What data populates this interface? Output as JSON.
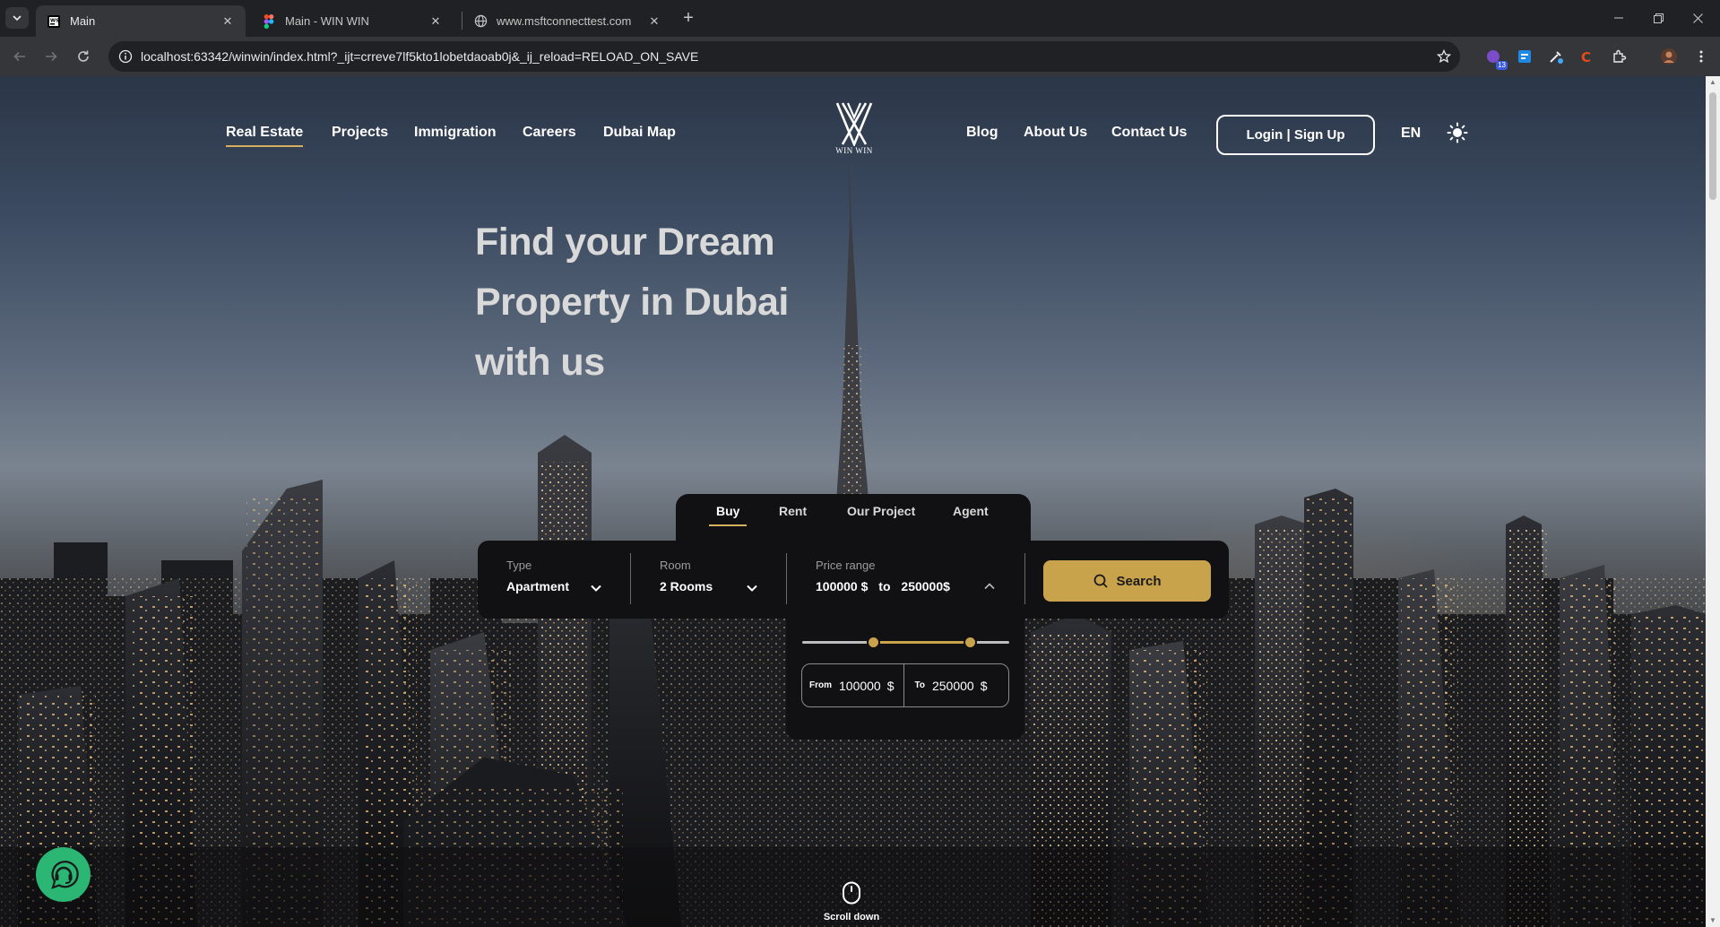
{
  "browser": {
    "tabs": [
      {
        "title": "Main",
        "active": true
      },
      {
        "title": "Main - WIN WIN",
        "active": false
      },
      {
        "title": "www.msftconnecttest.com",
        "active": false
      }
    ],
    "new_tab_label": "+",
    "url": "localhost:63342/winwin/index.html?_ijt=crreve7lf5kto1lobetdaoab0j&_ij_reload=RELOAD_ON_SAVE",
    "extension_badge": "13"
  },
  "site": {
    "nav_left": [
      "Real Estate",
      "Projects",
      "Immigration",
      "Careers",
      "Dubai Map"
    ],
    "active_nav": "Real Estate",
    "logo_caption": "WIN WIN",
    "nav_right": [
      "Blog",
      "About Us",
      "Contact Us"
    ],
    "login_label": "Login | Sign Up",
    "language": "EN"
  },
  "hero": {
    "title_lines": [
      "Find your Dream",
      "Property in Dubai",
      "with us"
    ]
  },
  "search": {
    "tabs": [
      "Buy",
      "Rent",
      "Our Project",
      "Agent"
    ],
    "active_tab": "Buy",
    "type": {
      "label": "Type",
      "value": "Apartment"
    },
    "room": {
      "label": "Room",
      "value": "2 Rooms"
    },
    "price": {
      "label": "Price range",
      "min_text": "100000 $",
      "joiner": "to",
      "max_text": "250000$",
      "from_prefix": "From",
      "from_value": "100000",
      "to_prefix": "To",
      "to_value": "250000",
      "currency": "$",
      "slider_min_fraction": 0.34,
      "slider_max_fraction": 0.81
    },
    "search_label": "Search"
  },
  "footer": {
    "scroll_label": "Scroll down"
  },
  "colors": {
    "accent_gold": "#c9a24c",
    "support_green": "#2bb673",
    "panel_dark": "#111113"
  }
}
